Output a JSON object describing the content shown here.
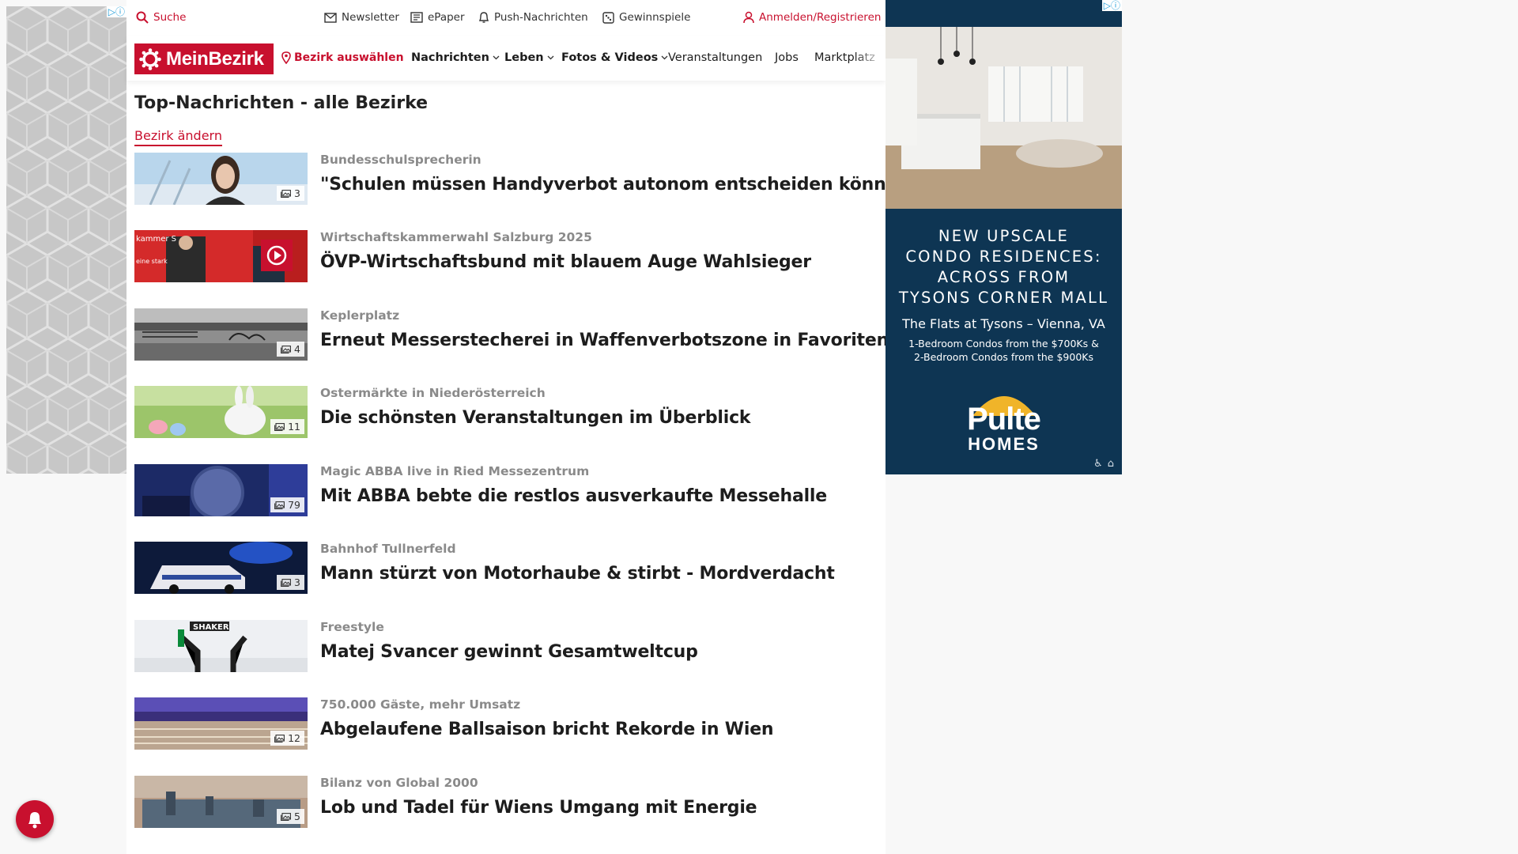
{
  "ads": {
    "left_badge": "▷ⓘ",
    "right_badge": "▷ⓘ",
    "right": {
      "headline_lines": [
        "NEW UPSCALE",
        "CONDO RESIDENCES:",
        "ACROSS FROM",
        "TYSONS CORNER MALL"
      ],
      "sub": "The Flats at Tysons – Vienna, VA",
      "detail_1": "1-Bedroom Condos from the $700Ks &",
      "detail_2": "2-Bedroom Condos from the $900Ks",
      "brand_1": "Pulte",
      "brand_2": "HOMES"
    }
  },
  "topbar": {
    "search": "Suche",
    "newsletter": "Newsletter",
    "epaper": "ePaper",
    "push": "Push-Nachrichten",
    "gewinnspiele": "Gewinnspiele",
    "login": "Anmelden/Registrieren"
  },
  "nav": {
    "logo": "MeinBezirk",
    "bezirk": "Bezirk auswählen",
    "items": [
      "Nachrichten",
      "Leben",
      "Fotos & Videos",
      "Veranstaltungen",
      "Jobs",
      "Marktplatz"
    ]
  },
  "page": {
    "title": "Top-Nachrichten - alle Bezirke",
    "change_link": "Bezirk ändern"
  },
  "articles": [
    {
      "kicker": "Bundesschulsprecherin",
      "headline": "\"Schulen müssen Handyverbot autonom entscheiden können\"",
      "count": "3",
      "thumb": "person"
    },
    {
      "kicker": "Wirtschaftskammerwahl Salzburg 2025",
      "headline": "ÖVP-Wirtschaftsbund mit blauem Auge Wahlsieger",
      "count": "",
      "thumb": "video"
    },
    {
      "kicker": "Keplerplatz",
      "headline": "Erneut Messerstecherei in Waffenverbotszone in Favoriten",
      "count": "4",
      "thumb": "subway"
    },
    {
      "kicker": "Ostermärkte in Niederösterreich",
      "headline": "Die schönsten Veranstaltungen im Überblick",
      "count": "11",
      "thumb": "bunny"
    },
    {
      "kicker": "Magic ABBA live in Ried Messezentrum",
      "headline": "Mit ABBA bebte die restlos ausverkaufte Messehalle",
      "count": "79",
      "thumb": "concert"
    },
    {
      "kicker": "Bahnhof Tullnerfeld",
      "headline": "Mann stürzt von Motorhaube & stirbt - Mordverdacht",
      "count": "3",
      "thumb": "police"
    },
    {
      "kicker": "Freestyle",
      "headline": "Matej Svancer gewinnt Gesamtweltcup",
      "count": "",
      "thumb": "ski"
    },
    {
      "kicker": "750.000 Gäste, mehr Umsatz",
      "headline": "Abgelaufene Ballsaison bricht Rekorde in Wien",
      "count": "12",
      "thumb": "ball"
    },
    {
      "kicker": "Bilanz von Global 2000",
      "headline": "Lob und Tadel für Wiens Umgang mit Energie",
      "count": "5",
      "thumb": "city"
    }
  ],
  "colors": {
    "brand_red": "#c8102e",
    "ad_navy": "#0e3553"
  }
}
